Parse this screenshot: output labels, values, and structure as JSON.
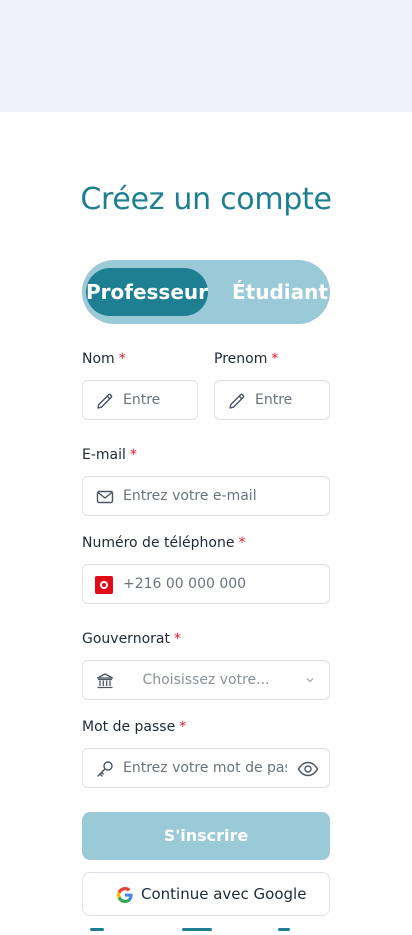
{
  "page": {
    "title": "Créez un compte"
  },
  "role_toggle": {
    "options": [
      "Professeur",
      "Étudiant"
    ],
    "selected": "Professeur"
  },
  "form": {
    "nom": {
      "label": "Nom",
      "placeholder": "Entre"
    },
    "prenom": {
      "label": "Prenom",
      "placeholder": "Entre"
    },
    "email": {
      "label": "E-mail",
      "placeholder": "Entrez votre e-mail"
    },
    "phone": {
      "label": "Numéro de téléphone",
      "placeholder": "+216 00 000 000"
    },
    "gouvernorat": {
      "label": "Gouvernorat",
      "placeholder": "Choisissez votre..."
    },
    "password": {
      "label": "Mot de passe",
      "placeholder": "Entrez votre mot de pas"
    },
    "required_mark": "*"
  },
  "actions": {
    "submit_label": "S'inscrire",
    "google_label": "Continue avec Google"
  },
  "colors": {
    "accent": "#1e7f93",
    "accent_light": "#9ac9d8",
    "required": "#e11d2e",
    "top_band": "#eef3fb"
  }
}
